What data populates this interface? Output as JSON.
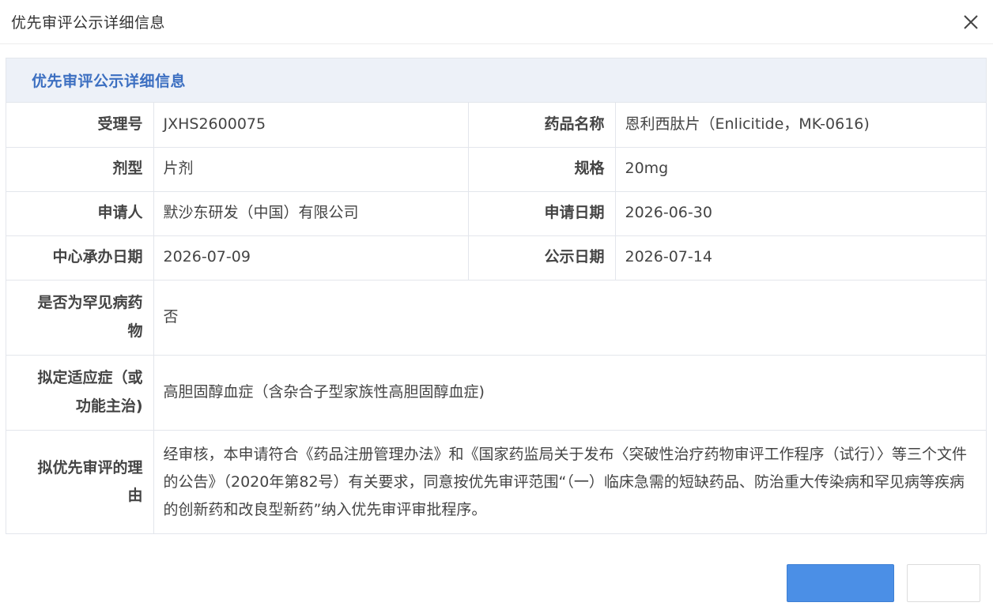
{
  "dialog": {
    "title": "优先审评公示详细信息",
    "close_icon": "close-icon"
  },
  "panel": {
    "title": "优先审评公示详细信息",
    "rows": [
      {
        "label": "受理号",
        "value": "JXHS2600075",
        "label2": "药品名称",
        "value2": "恩利西肽片（Enlicitide，MK-0616)"
      },
      {
        "label": "剂型",
        "value": "片剂",
        "label2": "规格",
        "value2": "20mg"
      },
      {
        "label": "申请人",
        "value": "默沙东研发（中国）有限公司",
        "label2": "申请日期",
        "value2": "2026-06-30"
      },
      {
        "label": "中心承办日期",
        "value": "2026-07-09",
        "label2": "公示日期",
        "value2": "2026-07-14"
      }
    ],
    "rare_disease": {
      "label": "是否为罕见病药物",
      "value": "否"
    },
    "indication": {
      "label": "拟定适应症（或功能主治)",
      "value": "高胆固醇血症（含杂合子型家族性高胆固醇血症)"
    },
    "reason": {
      "label": "拟优先审评的理由",
      "value": "经审核，本申请符合《药品注册管理办法》和《国家药监局关于发布〈突破性治疗药物审评工作程序（试行）〉等三个文件的公告》（2020年第82号）有关要求，同意按优先审评范围“（一）临床急需的短缺药品、防治重大传染病和罕见病等疾病的创新药和改良型新药”纳入优先审评审批程序。"
    }
  },
  "footer": {
    "primary_button": "",
    "secondary_button": ""
  },
  "colors": {
    "accent": "#3c6fc1",
    "header_bg": "#edf1f8",
    "border": "#e3e6ec",
    "primary_button": "#4b8fe6"
  }
}
